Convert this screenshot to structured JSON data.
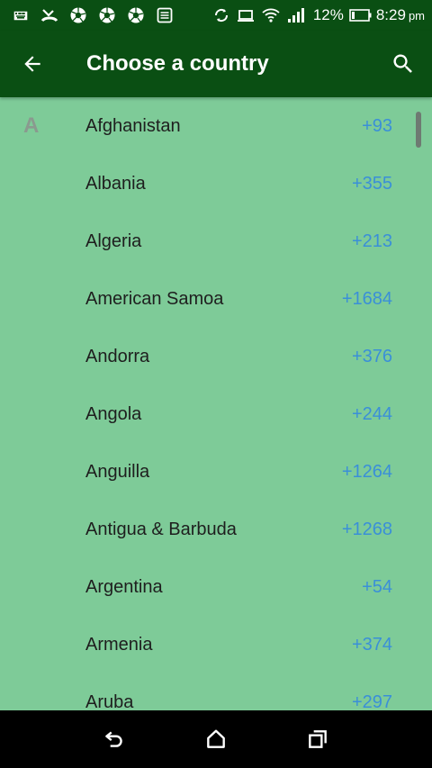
{
  "status_bar": {
    "left_icons": [
      "keyboard-icon",
      "missed-call-icon",
      "aperture-icon",
      "aperture-icon",
      "aperture-icon",
      "news-icon"
    ],
    "battery_level": "12%",
    "time": "8:29",
    "time_suffix": "pm"
  },
  "app_bar": {
    "title": "Choose a country",
    "back_icon": "arrow-back-icon",
    "search_icon": "search-icon",
    "background_color": "#0a4f13"
  },
  "list": {
    "background_color": "#7ecb98",
    "code_color": "#3a8fd8",
    "section_letter": "A",
    "countries": [
      {
        "name": "Afghanistan",
        "code": "+93"
      },
      {
        "name": "Albania",
        "code": "+355"
      },
      {
        "name": "Algeria",
        "code": "+213"
      },
      {
        "name": "American Samoa",
        "code": "+1684"
      },
      {
        "name": "Andorra",
        "code": "+376"
      },
      {
        "name": "Angola",
        "code": "+244"
      },
      {
        "name": "Anguilla",
        "code": "+1264"
      },
      {
        "name": "Antigua & Barbuda",
        "code": "+1268"
      },
      {
        "name": "Argentina",
        "code": "+54"
      },
      {
        "name": "Armenia",
        "code": "+374"
      },
      {
        "name": "Aruba",
        "code": "+297"
      }
    ]
  },
  "nav_bar": {
    "buttons": [
      "back-nav-icon",
      "home-icon",
      "recents-icon"
    ]
  }
}
